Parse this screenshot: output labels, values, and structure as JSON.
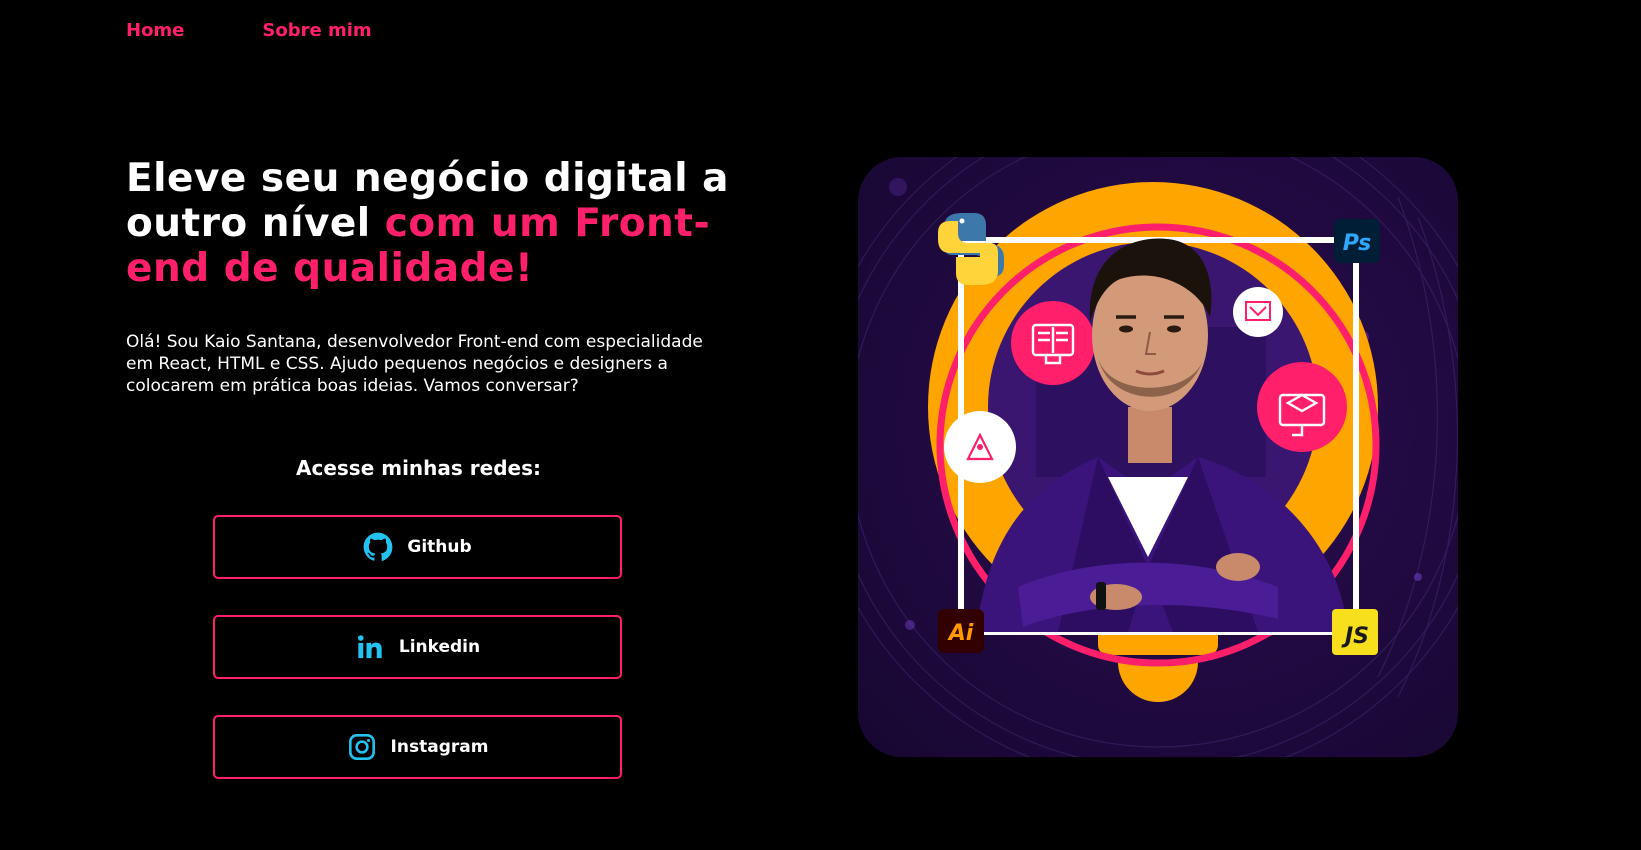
{
  "nav": {
    "home": "Home",
    "about": "Sobre mim"
  },
  "hero": {
    "title_white": "Eleve seu negócio digital a outro nível ",
    "title_accent": "com um Front-end de qualidade!",
    "intro": "Olá! Sou Kaio Santana, desenvolvedor Front-end com especialidade em React, HTML e CSS. Ajudo pequenos negócios e designers a colocarem em prática boas ideias. Vamos conversar?"
  },
  "social": {
    "title": "Acesse minhas redes:",
    "github": "Github",
    "linkedin": "Linkedin",
    "instagram": "Instagram"
  },
  "image": {
    "badges": {
      "photoshop": "Ps",
      "illustrator": "Ai",
      "javascript": "JS"
    }
  },
  "colors": {
    "accent": "#ff1f6b",
    "icon": "#22c3f0",
    "background": "#000000",
    "bulb": "#ffa500",
    "purple": "#2a0e52"
  }
}
